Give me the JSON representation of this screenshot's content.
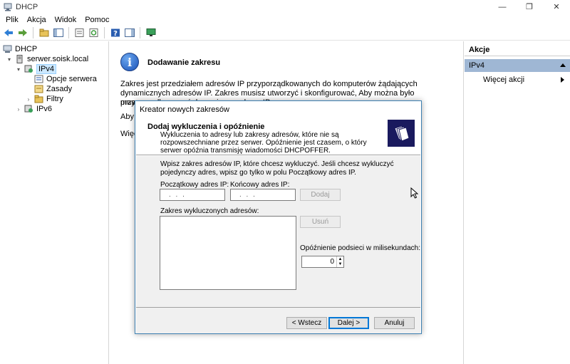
{
  "window": {
    "title": "DHCP"
  },
  "menu": [
    "Plik",
    "Akcja",
    "Widok",
    "Pomoc"
  ],
  "tree": {
    "root": "DHCP",
    "server": "serwer.soisk.local",
    "ipv4": "IPv4",
    "ipv4_children": [
      "Opcje serwera",
      "Zasady",
      "Filtry"
    ],
    "ipv6": "IPv6"
  },
  "center": {
    "title": "Dodawanie zakresu",
    "para1": "Zakres jest przedziałem adresów IP przyporządkowanych do komputerów żądających dynamicznych adresów IP. Zakres musisz utworzyć i skonfigurować, Aby można było przyporządkowywać dynamiczne adresy IP,",
    "para1_line3": "mus",
    "para2": "Aby",
    "para3": "Więc"
  },
  "actions": {
    "header": "Akcje",
    "context": "IPv4",
    "more": "Więcej akcji"
  },
  "wizard": {
    "title": "Kreator nowych zakresów",
    "header_title": "Dodaj wykluczenia i opóźnienie",
    "header_desc": "Wykluczenia to adresy lub zakresy adresów, które nie są rozpowszechniane przez serwer. Opóźnienie jest czasem, o który serwer opóźnia transmisję wiadomości DHCPOFFER.",
    "instruction": "Wpisz zakres adresów IP, które chcesz wykluczyć. Jeśli chcesz wykluczyć pojedynczy adres, wpisz go tylko w polu Początkowy adres IP.",
    "start_ip_label": "Początkowy adres IP:",
    "end_ip_label": "Końcowy adres IP:",
    "start_ip_value": ". . .",
    "end_ip_value": ". . .",
    "add_button": "Dodaj",
    "excluded_label": "Zakres wykluczonych adresów:",
    "remove_button": "Usuń",
    "delay_label": "Opóźnienie podsieci w milisekundach:",
    "delay_value": "0",
    "back_button": "< Wstecz",
    "next_button": "Dalej >",
    "cancel_button": "Anuluj"
  }
}
